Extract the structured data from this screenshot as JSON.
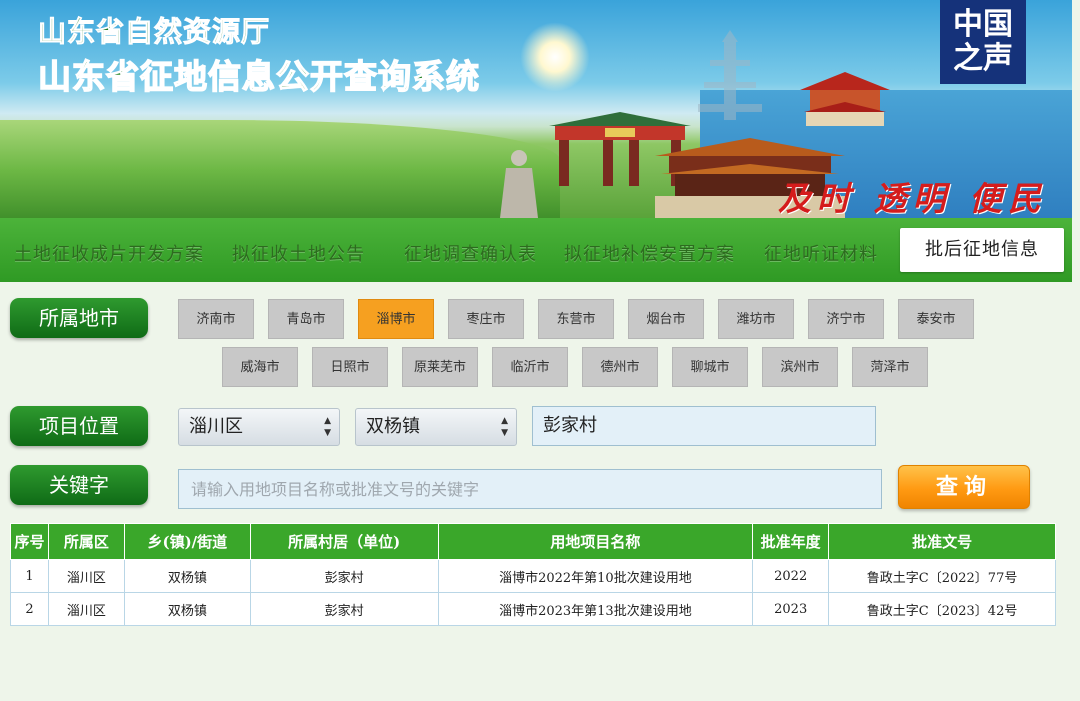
{
  "header": {
    "dept_title": "山东省自然资源厅",
    "system_title": "山东省征地信息公开查询系统",
    "slogan": "及时 透明 便民",
    "watermark_logo": "中国之声"
  },
  "nav": {
    "items": [
      {
        "label": "土地征收成片开发方案"
      },
      {
        "label": "拟征收土地公告"
      },
      {
        "label": "征地调查确认表"
      },
      {
        "label": "拟征地补偿安置方案"
      },
      {
        "label": "征地听证材料"
      },
      {
        "label": "批后征地信息",
        "active": true
      }
    ]
  },
  "filters": {
    "city_label": "所属地市",
    "cities_row1": [
      "济南市",
      "青岛市",
      "淄博市",
      "枣庄市",
      "东营市",
      "烟台市",
      "潍坊市",
      "济宁市",
      "泰安市"
    ],
    "cities_row2": [
      "威海市",
      "日照市",
      "原莱芜市",
      "临沂市",
      "德州市",
      "聊城市",
      "滨州市",
      "菏泽市"
    ],
    "selected_city": "淄博市",
    "location_label": "项目位置",
    "district": "淄川区",
    "town": "双杨镇",
    "village": "彭家村",
    "keyword_label": "关键字",
    "keyword_placeholder": "请输入用地项目名称或批准文号的关键字",
    "search_button": "查询"
  },
  "table": {
    "headers": [
      "序号",
      "所属区",
      "乡(镇)/街道",
      "所属村居（单位)",
      "用地项目名称",
      "批准年度",
      "批准文号"
    ],
    "rows": [
      [
        "1",
        "淄川区",
        "双杨镇",
        "彭家村",
        "淄博市2022年第10批次建设用地",
        "2022",
        "鲁政土字C〔2022〕77号"
      ],
      [
        "2",
        "淄川区",
        "双杨镇",
        "彭家村",
        "淄博市2023年第13批次建设用地",
        "2023",
        "鲁政土字C〔2023〕42号"
      ]
    ]
  },
  "colors": {
    "nav_green": "#3aa72a",
    "label_green": "#0f6b16",
    "selected_city_orange": "#f6a020",
    "search_orange": "#ff9a12",
    "slogan_red": "#d51c1c"
  }
}
